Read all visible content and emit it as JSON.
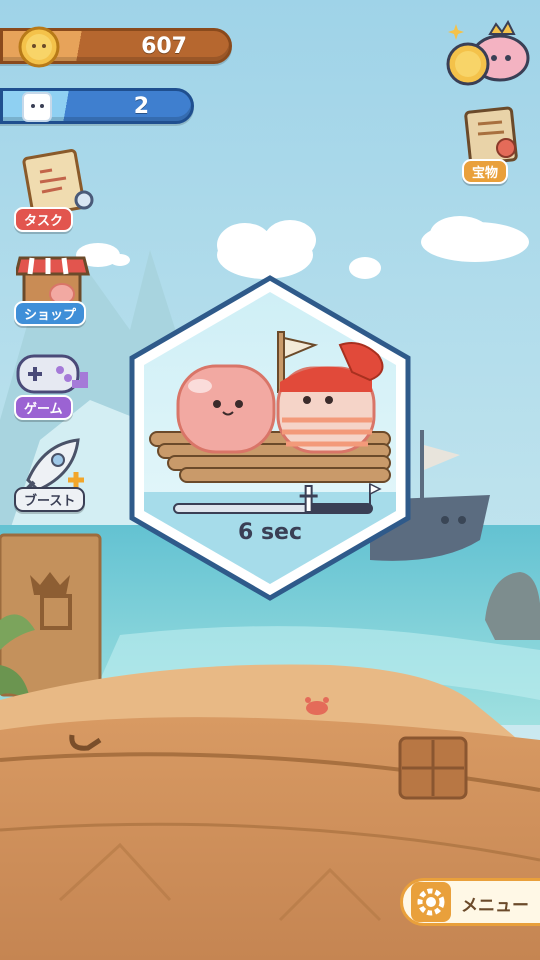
{
  "hud": {
    "coins": "607",
    "cubes": "2"
  },
  "side_menu": {
    "task_label": "タスク",
    "shop_label": "ショップ",
    "game_label": "ゲーム",
    "boost_label": "ブースト"
  },
  "treasure_label": "宝物",
  "menu_label": "メニュー",
  "raft_event": {
    "timer_text": "6 sec",
    "progress": 0.68
  },
  "colors": {
    "sky": "#bfe3ee",
    "sea": "#7dcfd8",
    "sand": "#e8b985",
    "coin_bar": "#c77a3a",
    "cube_bar": "#3f7fcf",
    "hex_border": "#2f5a8a"
  }
}
